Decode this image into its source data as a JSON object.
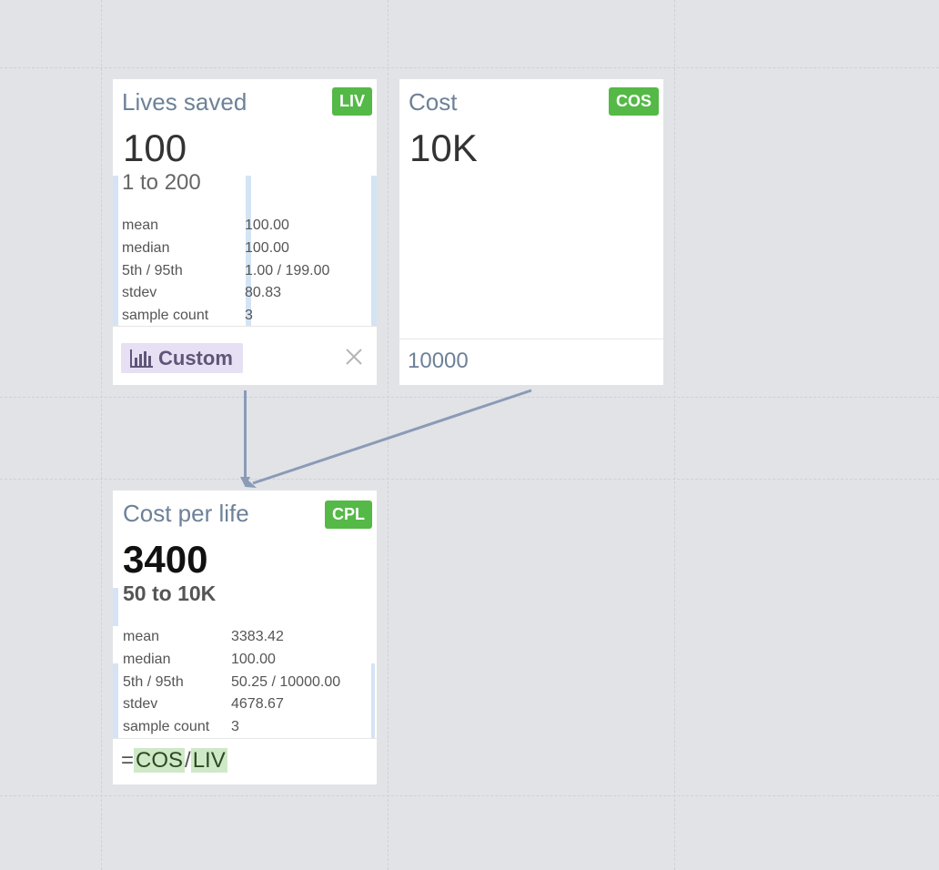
{
  "metrics": {
    "lives_saved": {
      "title": "Lives saved",
      "badge": "LIV",
      "value": "100",
      "range": "1 to 200",
      "stats": {
        "mean_label": "mean",
        "mean": "100.00",
        "median_label": "median",
        "median": "100.00",
        "pct_label": "5th / 95th",
        "pct": "1.00 / 199.00",
        "stdev_label": "stdev",
        "stdev": "80.83",
        "count_label": "sample count",
        "count": "3"
      },
      "footer_button": "Custom",
      "footer_icon": "bar-chart-icon",
      "close_icon": "close-icon"
    },
    "cost": {
      "title": "Cost",
      "badge": "COS",
      "value": "10K",
      "input": "10000"
    },
    "cost_per_life": {
      "title": "Cost per life",
      "badge": "CPL",
      "value": "3400",
      "range": "50 to 10K",
      "stats": {
        "mean_label": "mean",
        "mean": "3383.42",
        "median_label": "median",
        "median": "100.00",
        "pct_label": "5th / 95th",
        "pct": "50.25 / 10000.00",
        "stdev_label": "stdev",
        "stdev": "4678.67",
        "count_label": "sample count",
        "count": "3"
      },
      "formula": {
        "prefix": "=",
        "token_a": "COS",
        "op": "/",
        "token_b": "LIV"
      }
    }
  },
  "colors": {
    "canvas": "#e2e3e7",
    "badge": "#54b946",
    "arrow": "#8a9bb6",
    "title": "#6d8198"
  }
}
